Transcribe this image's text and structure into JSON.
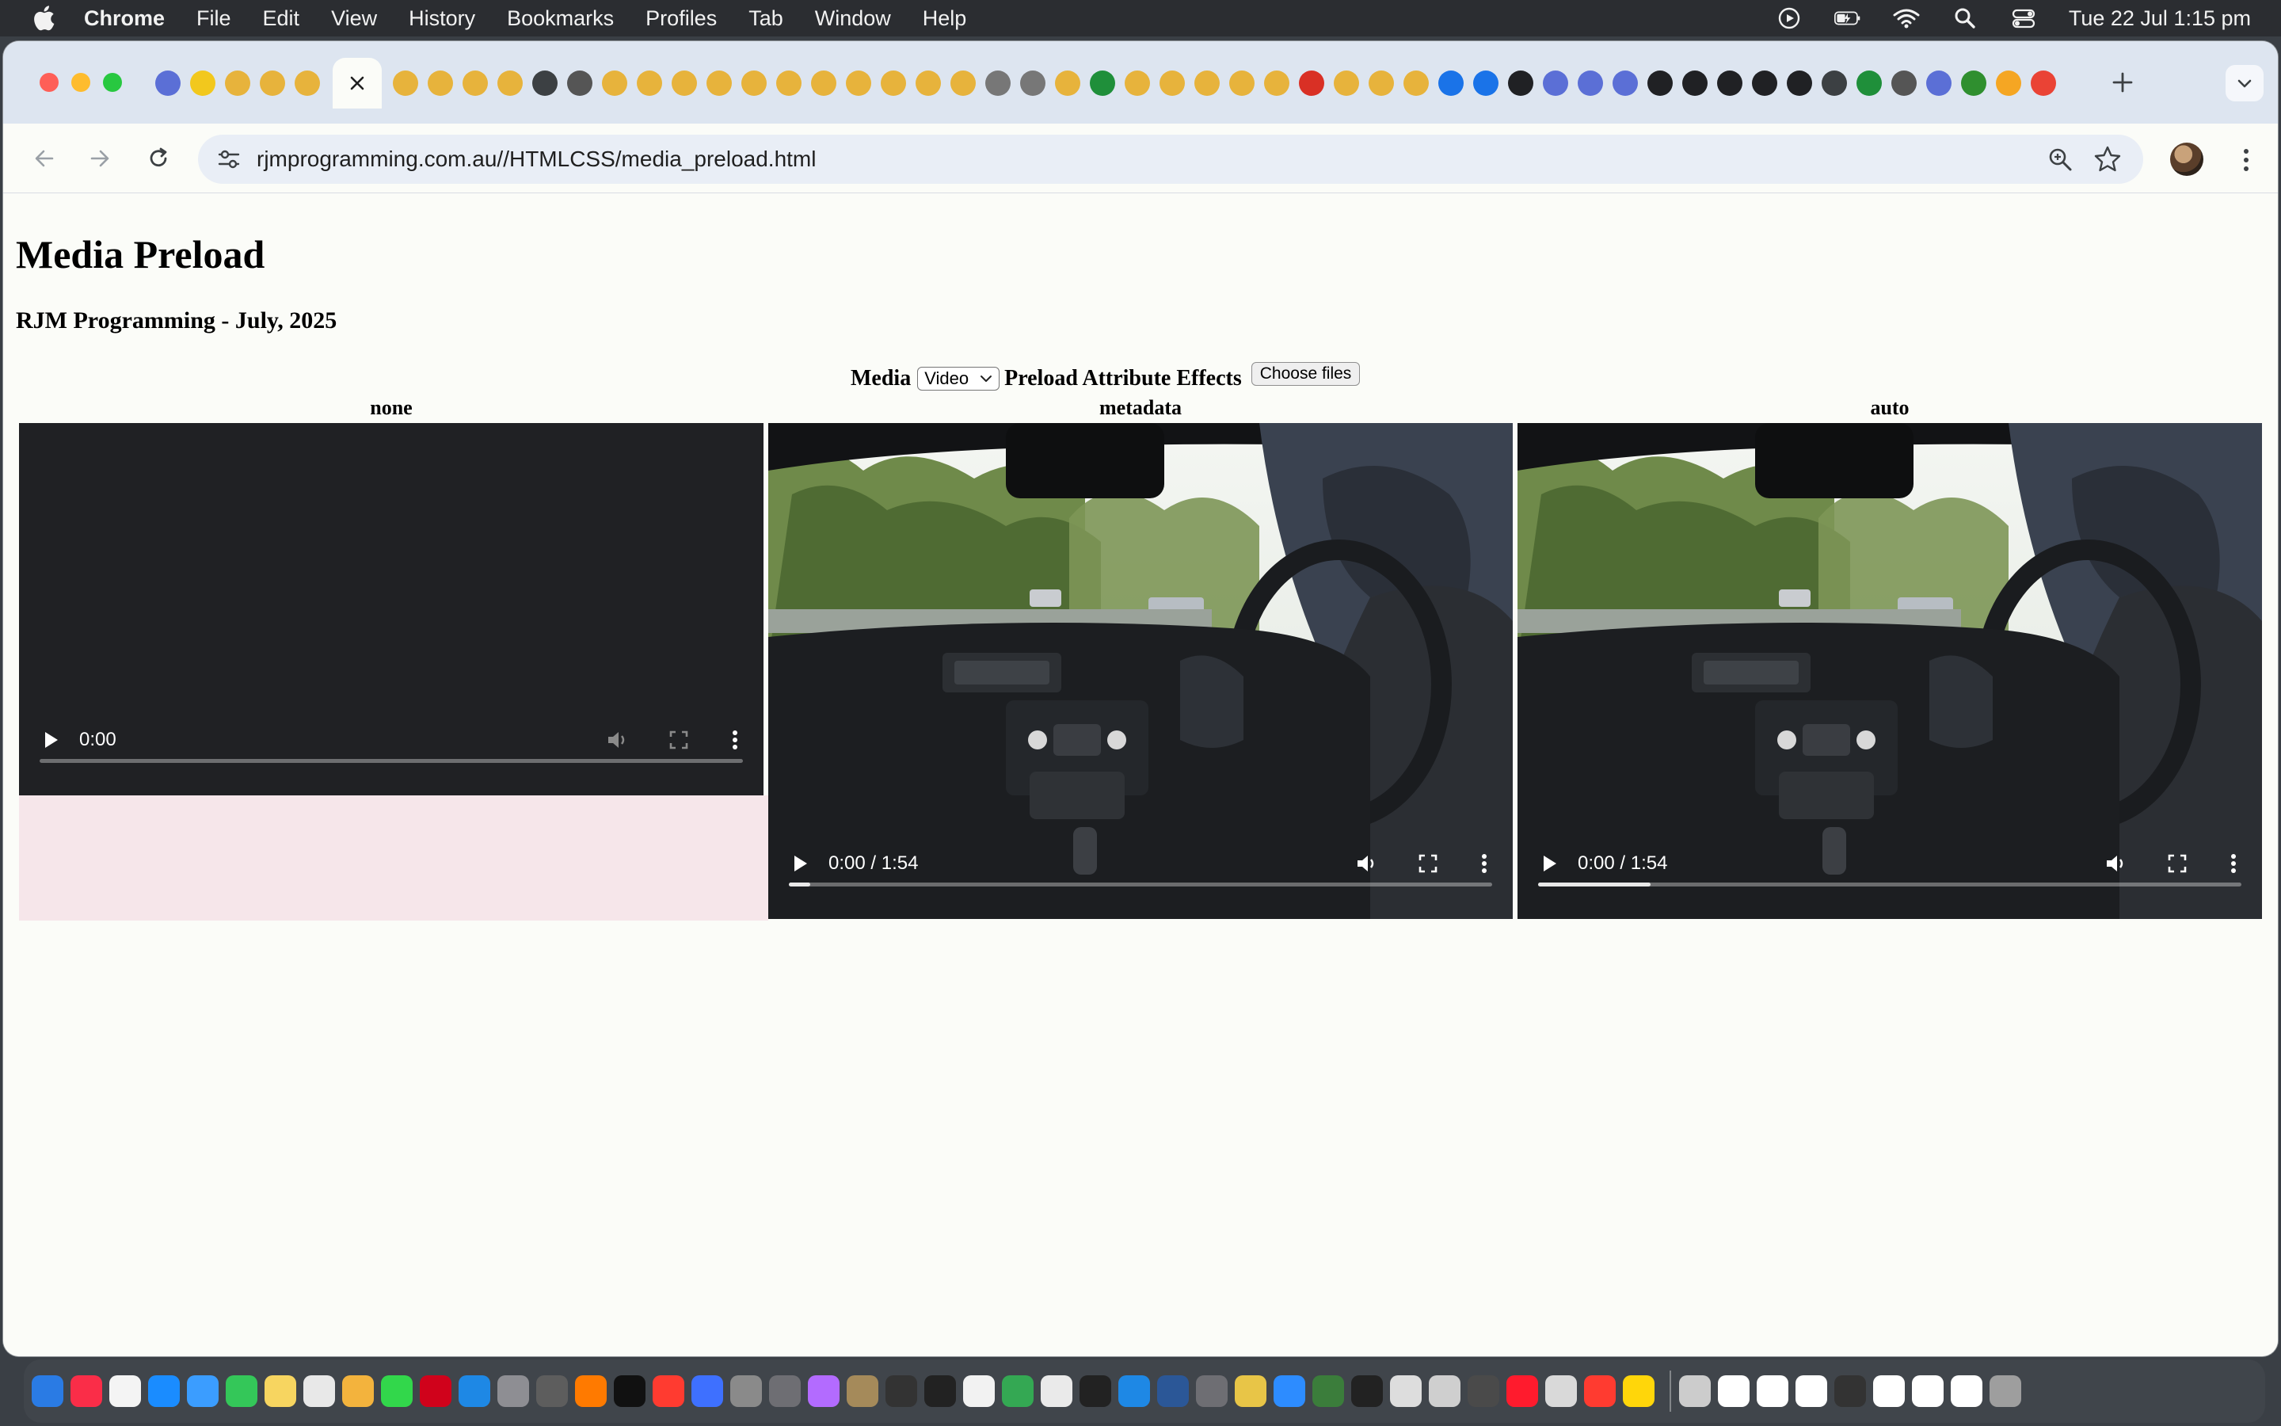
{
  "menubar": {
    "app_name": "Chrome",
    "items": [
      "File",
      "Edit",
      "View",
      "History",
      "Bookmarks",
      "Profiles",
      "Tab",
      "Window",
      "Help"
    ],
    "clock": "Tue 22 Jul  1:15 pm"
  },
  "browser": {
    "url": "rjmprogramming.com.au//HTMLCSS/media_preload.html",
    "favicon_colors": [
      "#5b6fd6",
      "#f2c81d",
      "#e7b33c",
      "#e7b33c",
      "#e7b33c",
      "#e7b33c",
      "#e7b33c",
      "#e7b33c",
      "#e7b33c",
      "#3c4043",
      "#555555",
      "#e7b33c",
      "#e7b33c",
      "#e7b33c",
      "#e7b33c",
      "#e7b33c",
      "#e7b33c",
      "#e7b33c",
      "#e7b33c",
      "#e7b33c",
      "#e7b33c",
      "#e7b33c",
      "#777777",
      "#777777",
      "#e7b33c",
      "#1f8f3a",
      "#e7b33c",
      "#e7b33c",
      "#e7b33c",
      "#e7b33c",
      "#e7b33c",
      "#d93025",
      "#e7b33c",
      "#e7b33c",
      "#e7b33c",
      "#1a73e8",
      "#1a73e8",
      "#202124",
      "#5b6fd6",
      "#5b6fd6",
      "#5b6fd6",
      "#202124",
      "#202124",
      "#202124",
      "#202124",
      "#202124",
      "#3c4043",
      "#1f8f3a",
      "#555555",
      "#5b6fd6",
      "#2f8f2f",
      "#f5a623",
      "#ea4335"
    ]
  },
  "page": {
    "title": "Media Preload",
    "subtitle": "RJM Programming - July, 2025",
    "controls": {
      "media_label": "Media",
      "media_value": "Video",
      "effects_label": "Preload Attribute Effects",
      "file_button": "Choose files"
    },
    "columns": [
      {
        "label": "none",
        "time": "0:00"
      },
      {
        "label": "metadata",
        "time": "0:00 / 1:54",
        "buffered": 0.03
      },
      {
        "label": "auto",
        "time": "0:00 / 1:54",
        "buffered": 0.16
      }
    ]
  },
  "dock": {
    "icon_colors": [
      "#2a7be4",
      "#fa2d48",
      "#f4f4f4",
      "#1a8cff",
      "#3b9dff",
      "#34c759",
      "#f7d560",
      "#e8e8e8",
      "#f3b33d",
      "#32d74b",
      "#d0021b",
      "#1e88e5",
      "#8e8e93",
      "#5d5d5d",
      "#ff7a00",
      "#111111",
      "#ff3b30",
      "#3e70ff",
      "#8a8a8a",
      "#6e6e73",
      "#b36bff",
      "#a58a5a",
      "#333333",
      "#222222",
      "#f2f2f2",
      "#34a853",
      "#eaeaea",
      "#222222",
      "#1e88e5",
      "#2b5797",
      "#6e6e73",
      "#e8c547",
      "#2d8cff",
      "#3b7d3b",
      "#222222",
      "#dddddd",
      "#cfcfcf",
      "#4a4a4a",
      "#ff1b2d",
      "#d9d9d9",
      "#ff3b30",
      "#ffd60a",
      "#cccccc",
      "#ffffff",
      "#ffffff",
      "#ffffff",
      "#333333",
      "#ffffff",
      "#ffffff",
      "#ffffff",
      "#9e9e9e"
    ]
  }
}
